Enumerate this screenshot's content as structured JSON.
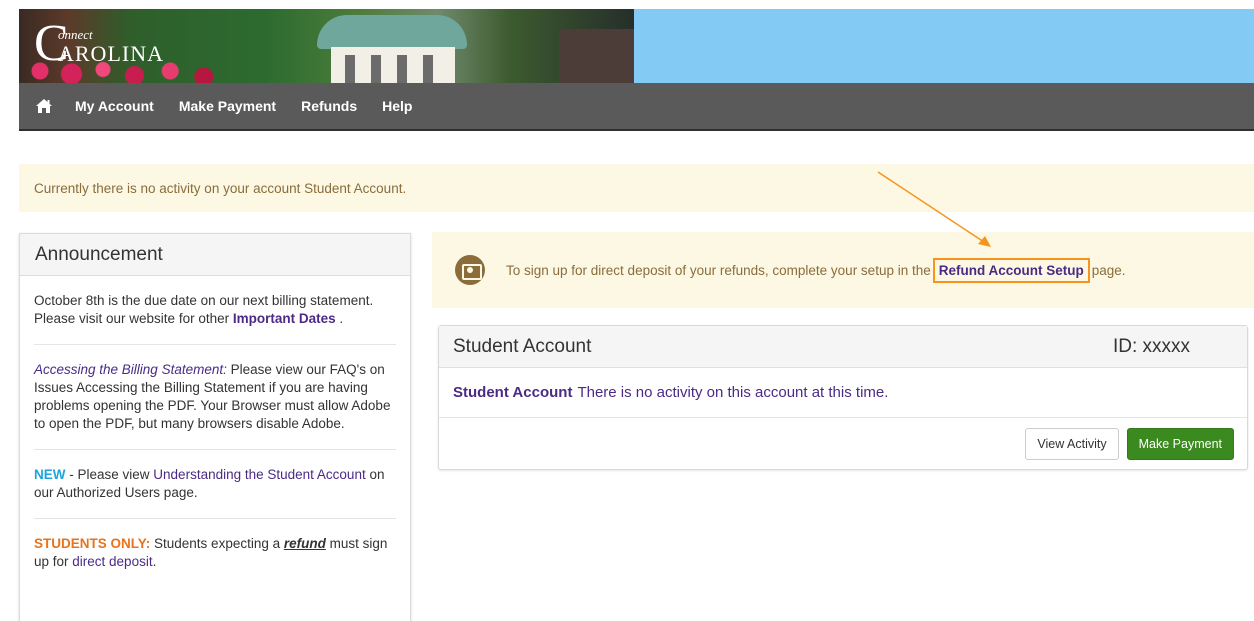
{
  "brand": {
    "logo_prefix": "C",
    "logo_top": "onnect",
    "logo_main": "AROLINA"
  },
  "nav": {
    "home_icon": "home-icon",
    "items": [
      "My Account",
      "Make Payment",
      "Refunds",
      "Help"
    ]
  },
  "notice": {
    "text": "Currently there is no activity on your account Student Account."
  },
  "announcement": {
    "title": "Announcement",
    "block1": {
      "text_a": "October 8th is the due date on our next billing statement. Please visit our website for other ",
      "link": "Important Dates",
      "text_b": " ."
    },
    "block2": {
      "lead": "Accessing the Billing Statement:",
      "text": " Please view our FAQ's on Issues Accessing the Billing Statement if you are having problems opening the PDF. Your Browser must allow Adobe to open the PDF, but many browsers disable Adobe."
    },
    "block3": {
      "tag": "NEW",
      "text_a": " - Please view ",
      "link": "Understanding the Student Account",
      "text_b": " on our Authorized Users page."
    },
    "block4": {
      "tag": "STUDENTS ONLY:",
      "text_a": " Students expecting a ",
      "emph": "refund",
      "text_b": " must sign up for ",
      "link": "direct deposit",
      "text_c": "."
    }
  },
  "direct_deposit": {
    "icon": "money-icon",
    "text_a": "To sign up for direct deposit of your refunds, complete your setup in the",
    "link": "Refund Account Setup",
    "text_b": "page."
  },
  "student_account": {
    "title": "Student Account",
    "id_label": "ID: xxxxx",
    "body_lead": "Student Account",
    "body_text": "There is no activity on this account at this time.",
    "view_activity": "View Activity",
    "make_payment": "Make Payment"
  },
  "colors": {
    "nav_bg": "#5a5a5a",
    "alert_bg": "#fcf8e3",
    "link_purple": "#4b2a86",
    "success_green": "#3b8a1f",
    "annotation_orange": "#f7941d"
  }
}
